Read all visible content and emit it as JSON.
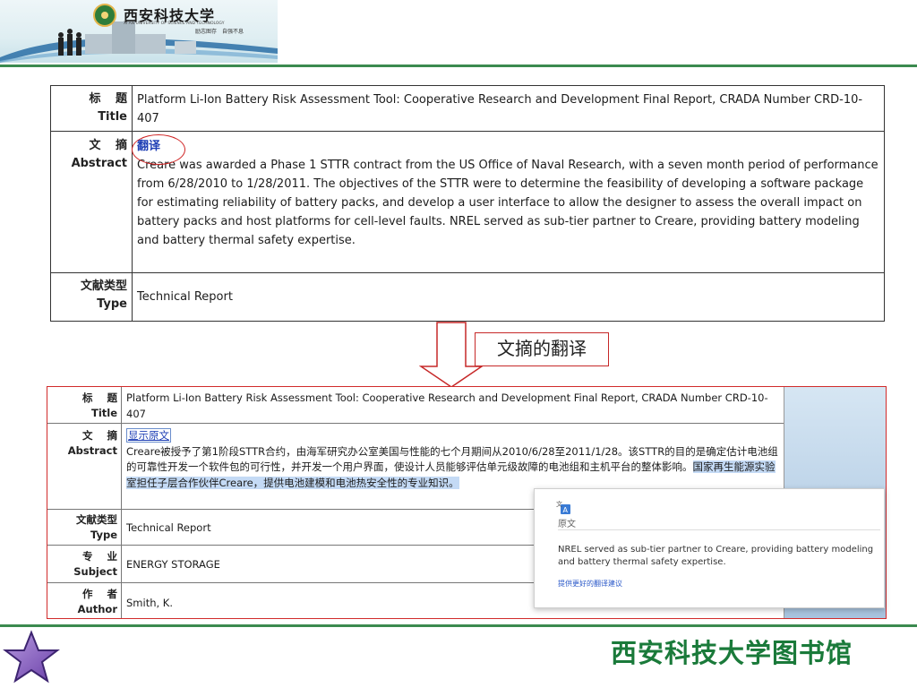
{
  "header": {
    "university_name_cn": "西安科技大学",
    "university_name_en": "XI'AN UNIVERSITY OF SCIENCE AND TECHNOLOGY",
    "motto": "励志图存　自强不息"
  },
  "top_record": {
    "title_label_cn": "标 题",
    "title_label_en": "Title",
    "title_value": "Platform Li-Ion Battery Risk Assessment Tool: Cooperative Research and Development Final Report, CRADA Number CRD-10-407",
    "abstract_label_cn": "文 摘",
    "abstract_label_en": "Abstract",
    "translate_link": "翻译",
    "abstract_value": "Creare was awarded a Phase 1 STTR contract from the US Office of Naval Research, with a seven month period of performance from 6/28/2010 to 1/28/2011. The objectives of the STTR were to determine the feasibility of developing a software package for estimating reliability of battery packs, and develop a user interface to allow the designer to assess the overall impact on battery packs and host platforms for cell-level faults. NREL served as sub-tier partner to Creare, providing battery modeling and battery thermal safety expertise.",
    "type_label_cn": "文献类型",
    "type_label_en": "Type",
    "type_value": "Technical Report"
  },
  "caption": "文摘的翻译",
  "bottom_record": {
    "title_label_cn": "标 题",
    "title_label_en": "Title",
    "title_value": "Platform Li-Ion Battery Risk Assessment Tool: Cooperative Research and Development Final Report, CRADA Number CRD-10-407",
    "abstract_label_cn": "文 摘",
    "abstract_label_en": "Abstract",
    "show_original_link": "显示原文",
    "abstract_translated_part1": "Creare被授予了第1阶段STTR合约，由海军研究办公室美国与性能的七个月期间从2010/6/28至2011/1/28。该STTR的目的是确定估计电池组的可靠性开发一个软件包的可行性，并开发一个用户界面，使设计人员能够评估单元级故障的电池组和主机平台的整体影响。",
    "abstract_translated_part2": "国家再生能源实验室担任子层合作伙伴Creare，提供电池建模和电池热安全性的专业知识。",
    "type_label_cn": "文献类型",
    "type_label_en": "Type",
    "type_value": "Technical Report",
    "subject_label_cn": "专 业",
    "subject_label_en": "Subject",
    "subject_value": "ENERGY STORAGE",
    "author_label_cn": "作 者",
    "author_label_en": "Author",
    "author_value": "Smith, K."
  },
  "popup": {
    "icon": "translate-icon",
    "label": "原文",
    "original_text": "NREL served as sub-tier partner to Creare, providing battery modeling and battery thermal safety expertise.",
    "suggest_link": "提供更好的翻译建议"
  },
  "footer": {
    "library_name": "西安科技大学图书馆",
    "star_icon": "star-icon"
  },
  "colors": {
    "accent_green": "#3b8a4f",
    "footer_text_green": "#1a7a3a",
    "highlight_red": "#d02323",
    "link_blue": "#1f3fb5"
  }
}
